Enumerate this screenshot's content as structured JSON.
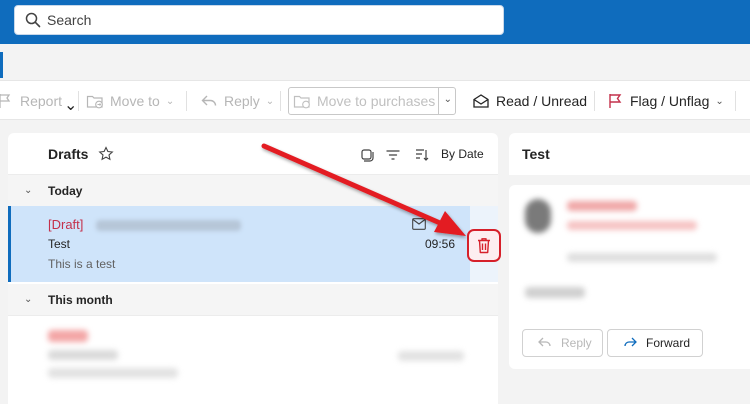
{
  "search": {
    "placeholder": "Search"
  },
  "toolbar": {
    "report_label": "Report",
    "move_to_label": "Move to",
    "reply_label": "Reply",
    "move_to_purchases_label": "Move to purchases",
    "read_unread_label": "Read / Unread",
    "flag_unflag_label": "Flag / Unflag"
  },
  "message_list": {
    "folder_title": "Drafts",
    "sort_label": "By Date",
    "groups": [
      {
        "label": "Today"
      },
      {
        "label": "This month"
      }
    ],
    "messages": [
      {
        "tag": "[Draft]",
        "subject": "Test",
        "time": "09:56",
        "preview": "This is a test"
      }
    ]
  },
  "reading_pane": {
    "title": "Test",
    "reply_label": "Reply",
    "forward_label": "Forward"
  },
  "colors": {
    "brand": "#0f6cbd",
    "selection": "#cfe4fa",
    "draft_tag": "#c4314b",
    "annotation": "#e31b23"
  }
}
